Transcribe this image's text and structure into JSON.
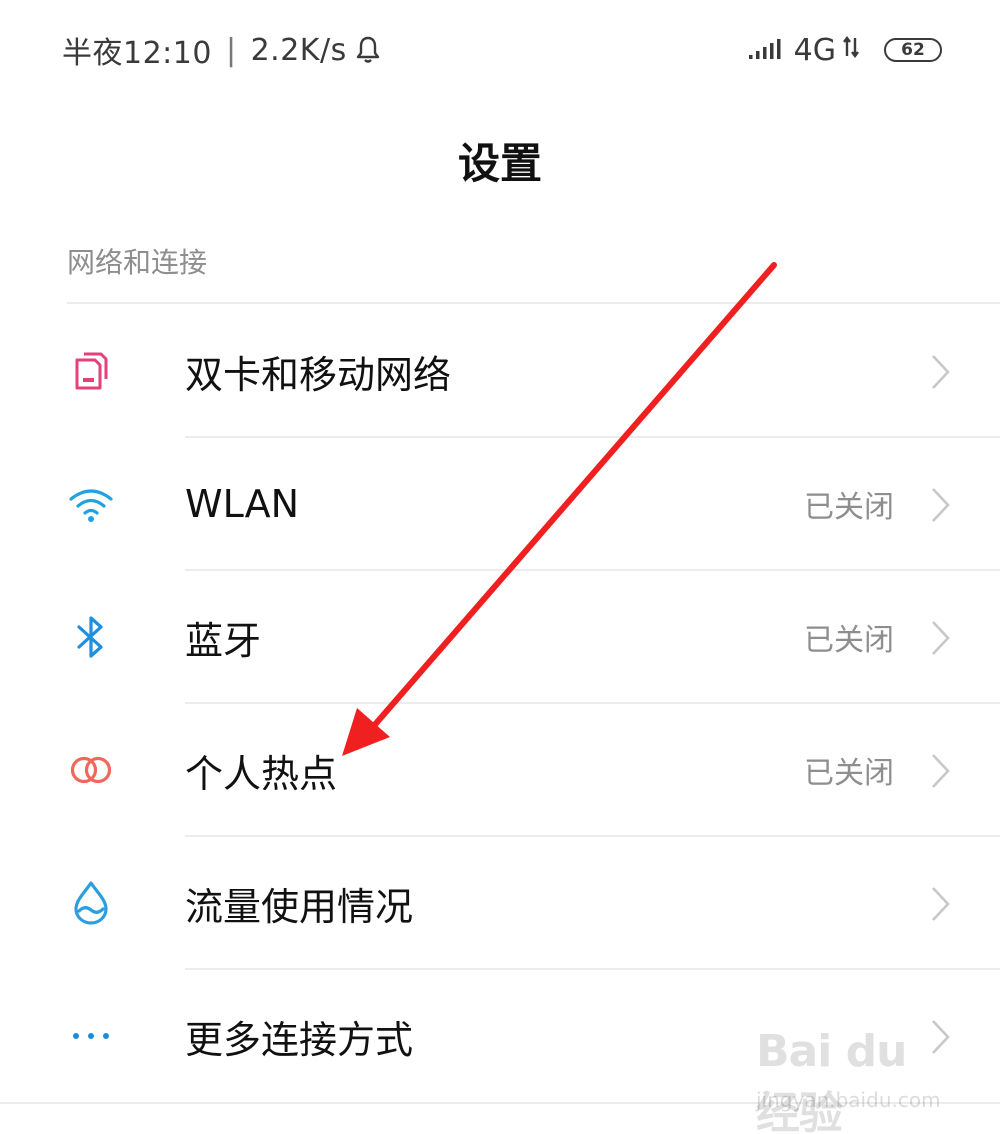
{
  "status_bar": {
    "time": "半夜12:10",
    "separator": "|",
    "speed": "2.2K/s",
    "network": "4G",
    "battery": "62"
  },
  "page": {
    "title": "设置"
  },
  "section": {
    "header": "网络和连接"
  },
  "rows": [
    {
      "label": "双卡和移动网络",
      "status": "",
      "icon": "dual-sim-icon",
      "color": "#e2417a"
    },
    {
      "label": "WLAN",
      "status": "已关闭",
      "icon": "wifi-icon",
      "color": "#1fa3e0"
    },
    {
      "label": "蓝牙",
      "status": "已关闭",
      "icon": "bluetooth-icon",
      "color": "#1f8fe0"
    },
    {
      "label": "个人热点",
      "status": "已关闭",
      "icon": "hotspot-icon",
      "color": "#f0675c"
    },
    {
      "label": "流量使用情况",
      "status": "",
      "icon": "data-usage-icon",
      "color": "#2b9ee0"
    },
    {
      "label": "更多连接方式",
      "status": "",
      "icon": "more-icon",
      "color": "#1a8fd8"
    }
  ],
  "watermark": {
    "logo": "Bai du 经验",
    "url": "jingyan.baidu.com"
  },
  "annotation": {
    "arrow_color": "#f02020"
  }
}
